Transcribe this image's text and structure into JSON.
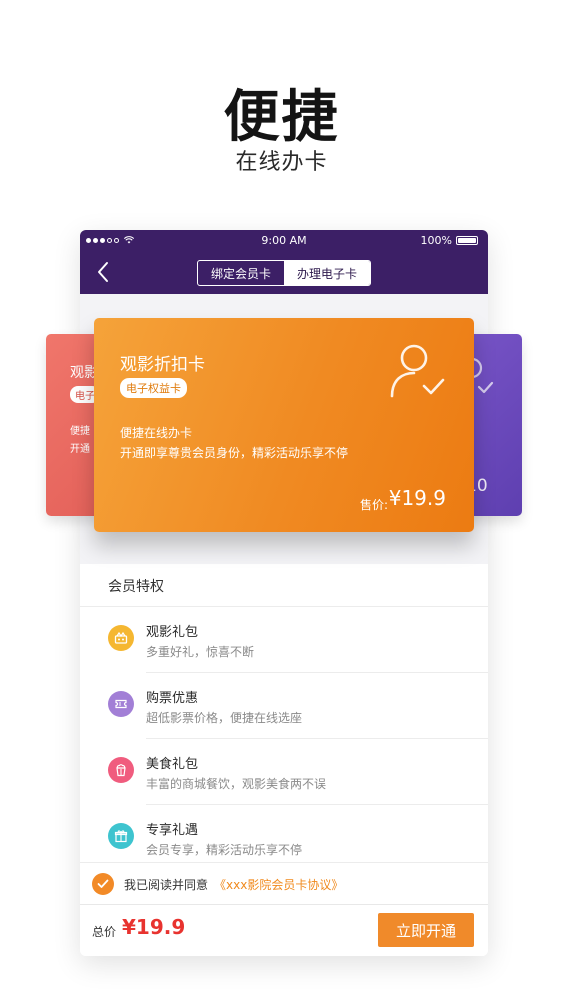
{
  "promo": {
    "title": "便捷",
    "subtitle": "在线办卡"
  },
  "status_bar": {
    "time": "9:00 AM",
    "battery": "100%"
  },
  "nav": {
    "tab_bind": "绑定会员卡",
    "tab_apply": "办理电子卡",
    "active_tab": "办理电子卡"
  },
  "cards": {
    "left": {
      "title": "观影",
      "badge": "电子",
      "line1": "便捷",
      "line2": "开通"
    },
    "main": {
      "title": "观影折扣卡",
      "badge": "电子权益卡",
      "line1": "便捷在线办卡",
      "line2": "开通即享尊贵会员身份，精彩活动乐享不停",
      "price_label": "售价:",
      "price": "¥19.9"
    },
    "right": {
      "price": "10"
    }
  },
  "privileges": {
    "title": "会员特权",
    "items": [
      {
        "title": "观影礼包",
        "desc": "多重好礼，惊喜不断",
        "icon": "gift-box-icon",
        "color": "#f5b731"
      },
      {
        "title": "购票优惠",
        "desc": "超低影票价格，便捷在线选座",
        "icon": "ticket-icon",
        "color": "#a27fd6"
      },
      {
        "title": "美食礼包",
        "desc": "丰富的商城餐饮，观影美食两不误",
        "icon": "popcorn-icon",
        "color": "#f05c7e"
      },
      {
        "title": "专享礼遇",
        "desc": "会员专享，精彩活动乐享不停",
        "icon": "present-icon",
        "color": "#3ec4cf"
      }
    ]
  },
  "agreement": {
    "prefix": "我已阅读并同意",
    "link": "《xxx影院会员卡协议》"
  },
  "footer": {
    "total_label": "总价",
    "total_value": "¥19.9",
    "button": "立即开通"
  },
  "colors": {
    "nav": "#3c1f66",
    "accent": "#f08a2a",
    "price": "#e8332f"
  }
}
